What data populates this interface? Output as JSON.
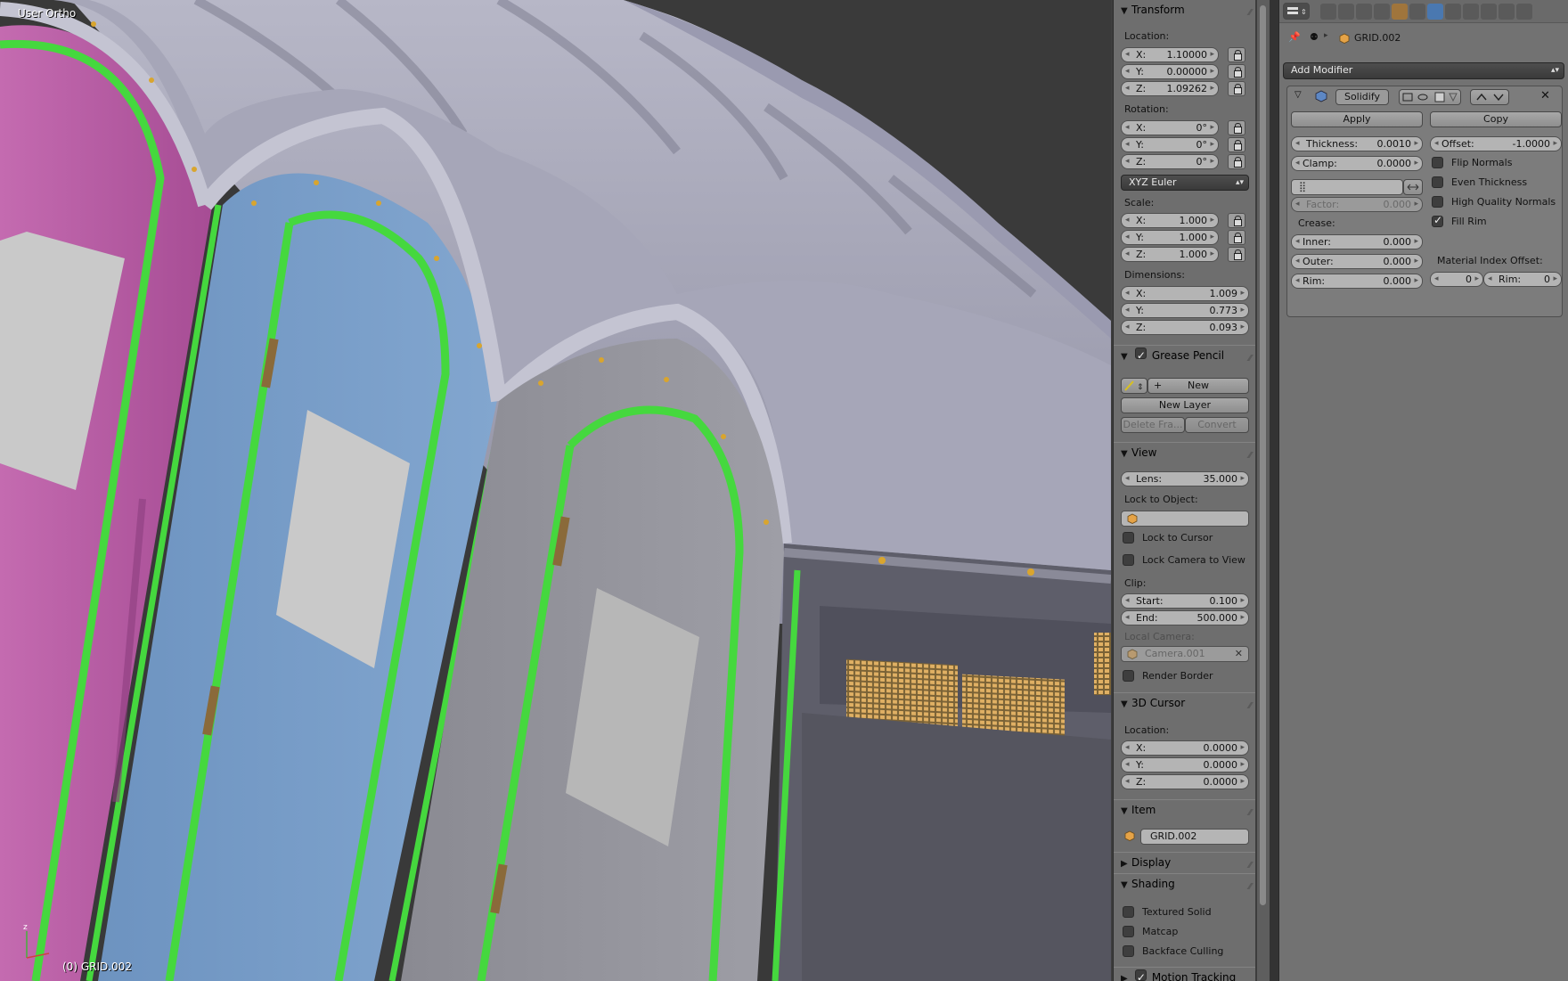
{
  "viewport": {
    "view_label": "User Ortho",
    "object_label": "(0) GRID.002"
  },
  "npanel": {
    "transform": {
      "title": "Transform",
      "location_label": "Location:",
      "location": [
        {
          "axis": "X:",
          "value": "1.10000"
        },
        {
          "axis": "Y:",
          "value": "0.00000"
        },
        {
          "axis": "Z:",
          "value": "1.09262"
        }
      ],
      "rotation_label": "Rotation:",
      "rotation": [
        {
          "axis": "X:",
          "value": "0°"
        },
        {
          "axis": "Y:",
          "value": "0°"
        },
        {
          "axis": "Z:",
          "value": "0°"
        }
      ],
      "rotation_mode": "XYZ Euler",
      "scale_label": "Scale:",
      "scale": [
        {
          "axis": "X:",
          "value": "1.000"
        },
        {
          "axis": "Y:",
          "value": "1.000"
        },
        {
          "axis": "Z:",
          "value": "1.000"
        }
      ],
      "dimensions_label": "Dimensions:",
      "dimensions": [
        {
          "axis": "X:",
          "value": "1.009"
        },
        {
          "axis": "Y:",
          "value": "0.773"
        },
        {
          "axis": "Z:",
          "value": "0.093"
        }
      ]
    },
    "grease_pencil": {
      "title": "Grease Pencil",
      "enabled": true,
      "new_label": "New",
      "new_layer_label": "New Layer",
      "delete_frame_label": "Delete Fra...",
      "convert_label": "Convert"
    },
    "view": {
      "title": "View",
      "lens_label": "Lens:",
      "lens_value": "35.000",
      "lock_to_object_label": "Lock to Object:",
      "lock_to_cursor_label": "Lock to Cursor",
      "lock_camera_label": "Lock Camera to View",
      "clip_label": "Clip:",
      "clip_start_label": "Start:",
      "clip_start": "0.100",
      "clip_end_label": "End:",
      "clip_end": "500.000",
      "local_camera_label": "Local Camera:",
      "local_camera_value": "Camera.001",
      "render_border_label": "Render Border"
    },
    "cursor": {
      "title": "3D Cursor",
      "location_label": "Location:",
      "location": [
        {
          "axis": "X:",
          "value": "0.0000"
        },
        {
          "axis": "Y:",
          "value": "0.0000"
        },
        {
          "axis": "Z:",
          "value": "0.0000"
        }
      ]
    },
    "item": {
      "title": "Item",
      "name": "GRID.002"
    },
    "display": {
      "title": "Display"
    },
    "shading": {
      "title": "Shading",
      "textured_solid": "Textured Solid",
      "matcap": "Matcap",
      "backface_culling": "Backface Culling"
    },
    "motion_tracking": {
      "title": "Motion Tracking",
      "enabled": true
    }
  },
  "properties": {
    "breadcrumb_object": "GRID.002",
    "add_modifier_label": "Add Modifier",
    "modifier": {
      "name": "Solidify",
      "apply_label": "Apply",
      "copy_label": "Copy",
      "thickness_label": "Thickness:",
      "thickness": "0.0010",
      "offset_label": "Offset:",
      "offset": "-1.0000",
      "clamp_label": "Clamp:",
      "clamp": "0.0000",
      "factor_label": "Factor:",
      "factor": "0.000",
      "crease_label": "Crease:",
      "inner_label": "Inner:",
      "inner": "0.000",
      "outer_label": "Outer:",
      "outer": "0.000",
      "rim_label": "Rim:",
      "rim": "0.000",
      "flip_normals": "Flip Normals",
      "even_thickness": "Even Thickness",
      "high_quality_normals": "High Quality Normals",
      "fill_rim": "Fill Rim",
      "fill_rim_checked": true,
      "material_index_label": "Material Index Offset:",
      "material_index_value": "0",
      "material_rim_label": "Rim:",
      "material_rim_value": "0"
    }
  },
  "colors": {
    "pink_door": "#b4529e",
    "blue_door": "#6f97c4",
    "grey_door": "#8f8f96",
    "trim_green": "#45d83e",
    "roof": "#a9a9bd",
    "vent": "#c8a05a"
  }
}
